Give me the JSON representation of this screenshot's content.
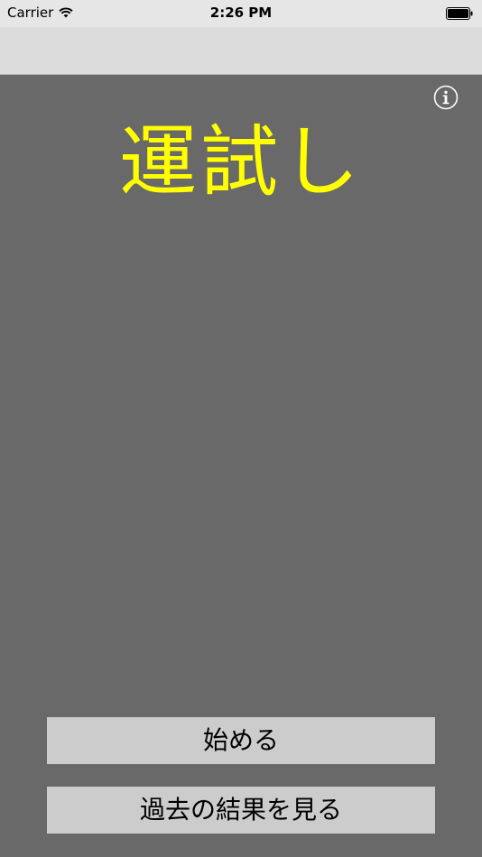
{
  "status_bar": {
    "carrier": "Carrier",
    "time": "2:26 PM",
    "wifi_icon": "wifi-icon",
    "battery_icon": "battery-icon"
  },
  "main": {
    "title": "運試し",
    "info_icon": "info-icon"
  },
  "buttons": {
    "start_label": "始める",
    "history_label": "過去の結果を見る"
  },
  "colors": {
    "background": "#696969",
    "title": "#ffff00",
    "button": "#cccccc",
    "nav_bar": "#dcdcdc"
  }
}
